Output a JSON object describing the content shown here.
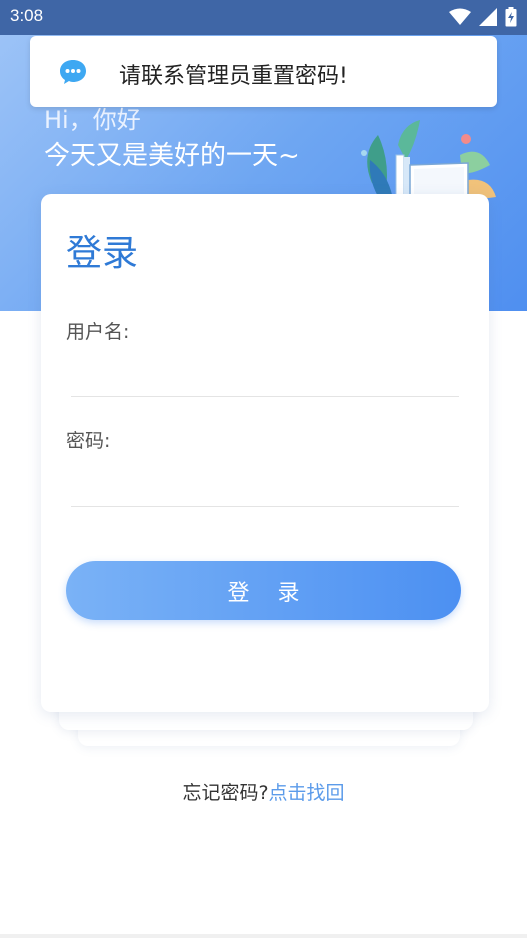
{
  "status_bar": {
    "time": "3:08"
  },
  "toast": {
    "message": "请联系管理员重置密码!"
  },
  "hero": {
    "greeting_line1": "Hi，你好",
    "greeting_line2": "今天又是美好的一天~"
  },
  "login": {
    "title": "登录",
    "username_label": "用户名:",
    "username_value": "",
    "password_label": "密码:",
    "password_value": "",
    "submit_label": "登录"
  },
  "footer": {
    "forgot_text": "忘记密码?",
    "recover_link": "点击找回"
  },
  "colors": {
    "accent": "#4c90f2",
    "title": "#2f7ad6",
    "link": "#5b9bea",
    "status_bar": "#3f66a6"
  },
  "icons": [
    "wifi-icon",
    "signal-icon",
    "battery-icon",
    "chat-bubble-icon",
    "book-illustration"
  ]
}
